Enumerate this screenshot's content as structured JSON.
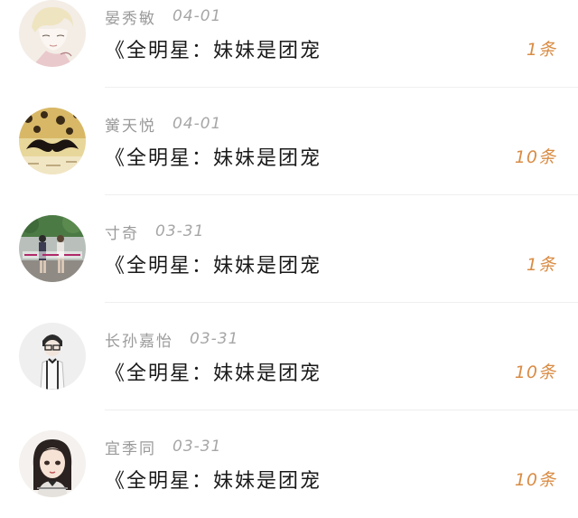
{
  "items": [
    {
      "name": "晏秀敏",
      "date": "04-01",
      "title": "《全明星：妹妹是团宠",
      "count": "1条",
      "avatar_icon": "anime-sketch-avatar"
    },
    {
      "name": "黉天悦",
      "date": "04-01",
      "title": "《全明星：妹妹是团宠",
      "count": "10条",
      "avatar_icon": "mustache-avatar"
    },
    {
      "name": "寸奇",
      "date": "03-31",
      "title": "《全明星：妹妹是团宠",
      "count": "1条",
      "avatar_icon": "couple-photo-avatar"
    },
    {
      "name": "长孙嘉怡",
      "date": "03-31",
      "title": "《全明星：妹妹是团宠",
      "count": "10条",
      "avatar_icon": "glasses-person-avatar"
    },
    {
      "name": "宜季同",
      "date": "03-31",
      "title": "《全明星：妹妹是团宠",
      "count": "10条",
      "avatar_icon": "illustrated-girl-avatar"
    }
  ],
  "colors": {
    "count": "#d98c45",
    "meta": "#9a9a9a",
    "title": "#1a1a1a",
    "divider": "#efefef"
  }
}
